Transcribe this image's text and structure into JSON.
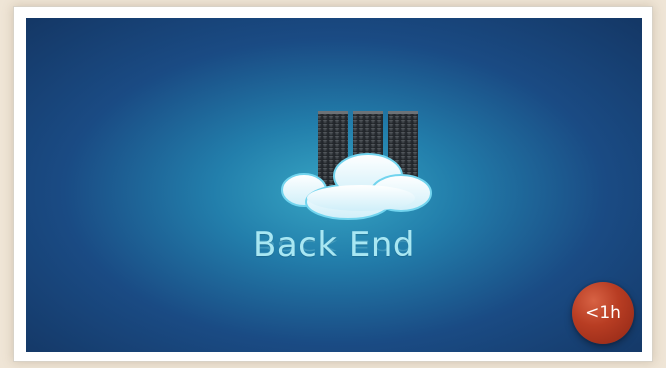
{
  "thumbnail": {
    "title": "Back End",
    "duration_badge": "<1h",
    "icon_name": "cloud-server-icon",
    "colors": {
      "background_dark": "#143765",
      "background_mid": "#227eab",
      "background_light": "#37a6c4",
      "title_text": "#a8e7f3",
      "badge": "#b83d23"
    }
  }
}
